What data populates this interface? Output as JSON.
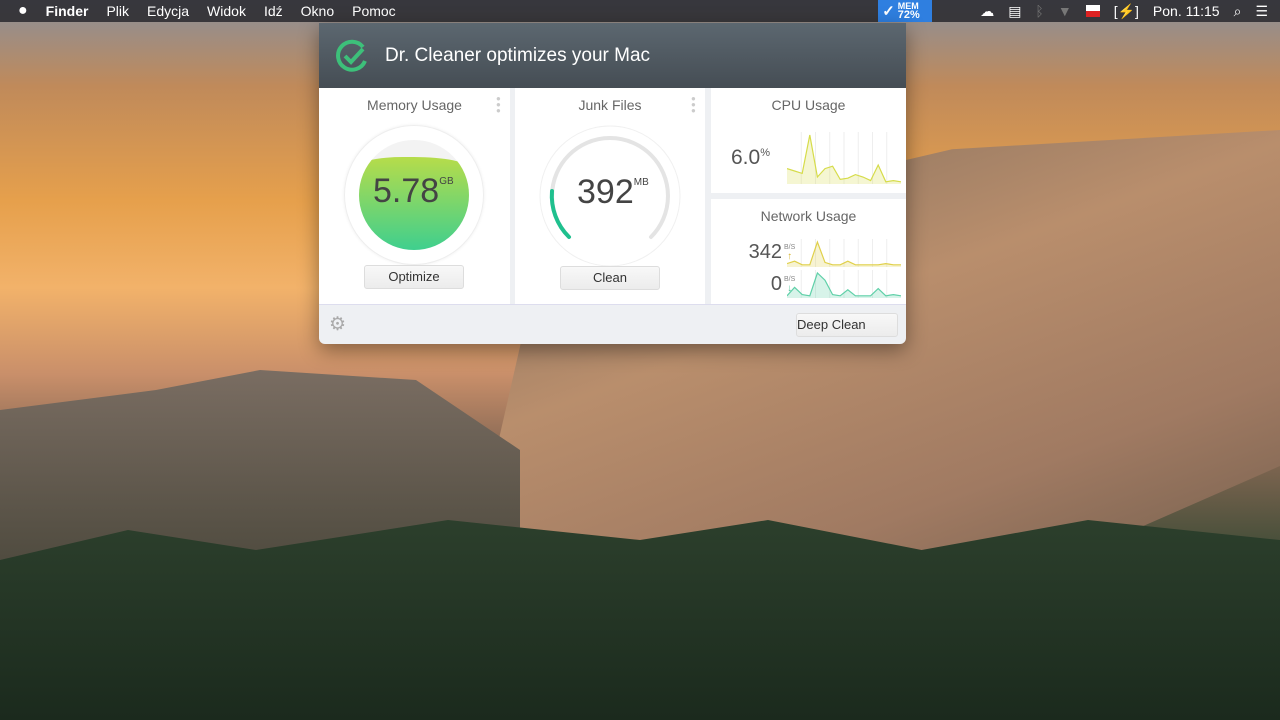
{
  "menubar": {
    "apple": "",
    "app": "Finder",
    "items": [
      "Plik",
      "Edycja",
      "Widok",
      "Idź",
      "Okno",
      "Pomoc"
    ],
    "mem_label": "MEM",
    "mem_value": "72%",
    "clock": "Pon. 11:15"
  },
  "panel": {
    "title": "Dr. Cleaner optimizes your Mac",
    "memory": {
      "title": "Memory Usage",
      "value": "5.78",
      "unit": "GB",
      "button": "Optimize",
      "fill_fraction": 0.72
    },
    "junk": {
      "title": "Junk Files",
      "value": "392",
      "unit": "MB",
      "button": "Clean",
      "progress_fraction": 0.2
    },
    "cpu": {
      "title": "CPU Usage",
      "value": "6.0",
      "unit": "%",
      "history": [
        12,
        10,
        8,
        40,
        5,
        12,
        14,
        3,
        4,
        7,
        5,
        2,
        15,
        1,
        2,
        1
      ]
    },
    "network": {
      "title": "Network Usage",
      "up_value": "342",
      "up_unit": "B/S",
      "down_value": "0",
      "down_unit": "B/S",
      "up_history": [
        2,
        4,
        1,
        1,
        20,
        3,
        1,
        1,
        4,
        1,
        1,
        1,
        1,
        2,
        1,
        1
      ],
      "down_history": [
        1,
        8,
        2,
        1,
        20,
        14,
        2,
        1,
        6,
        1,
        1,
        1,
        7,
        1,
        2,
        1
      ]
    },
    "deep_clean": "Deep Clean"
  },
  "colors": {
    "accent": "#2ec28c",
    "cpu": "#d6dc4a",
    "up": "#e0d04a",
    "down": "#5fd0a8"
  }
}
